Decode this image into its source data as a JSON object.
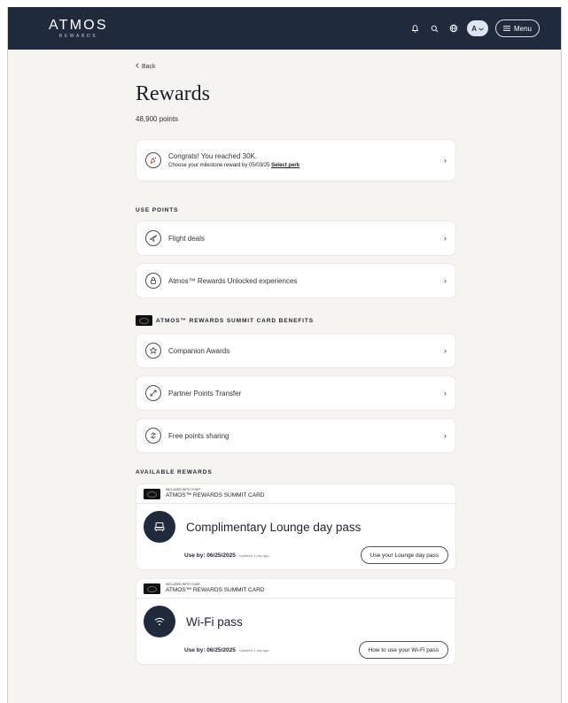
{
  "header": {
    "logo_main": "ATMOS",
    "logo_sub": "REWARDS",
    "avatar_initial": "A",
    "menu_label": "Menu"
  },
  "page": {
    "back_label": "Back",
    "title": "Rewards",
    "points": "48,900 points"
  },
  "milestone": {
    "title": "Congrats! You reached 30K.",
    "subtitle": "Choose your milestone reward by 05/03/25",
    "link": "Select perk"
  },
  "use_points": {
    "heading": "USE POINTS",
    "items": [
      {
        "label": "Flight deals",
        "icon": "plane-icon"
      },
      {
        "label": "Atmos™ Rewards Unlocked experiences",
        "icon": "lock-icon"
      }
    ]
  },
  "card_benefits": {
    "heading": "ATMOS™ REWARDS SUMMIT CARD BENEFITS",
    "items": [
      {
        "label": "Companion Awards",
        "icon": "star-icon"
      },
      {
        "label": "Partner Points Transfer",
        "icon": "transfer-icon"
      },
      {
        "label": "Free points sharing",
        "icon": "share-icon"
      }
    ]
  },
  "available_rewards": {
    "heading": "AVAILABLE REWARDS",
    "items": [
      {
        "included": "INCLUDED WITH YOUR",
        "card_name": "ATMOS™ REWARDS SUMMIT CARD",
        "title": "Complimentary Lounge day pass",
        "use_by": "Use by: 06/25/2025",
        "updated": "Updated 1 day ago",
        "button": "Use your Lounge day pass",
        "icon": "lounge-chair-icon"
      },
      {
        "included": "INCLUDED WITH YOUR",
        "card_name": "ATMOS™ REWARDS SUMMIT CARD",
        "title": "Wi-Fi pass",
        "use_by": "Use by: 06/25/2025",
        "updated": "Updated 1 day ago",
        "button": "How to use your Wi-Fi pass",
        "icon": "wifi-icon"
      }
    ]
  },
  "colors": {
    "header_bg": "#1f2a3d",
    "page_bg": "#f6f4f1",
    "card_bg": "#ffffff"
  }
}
